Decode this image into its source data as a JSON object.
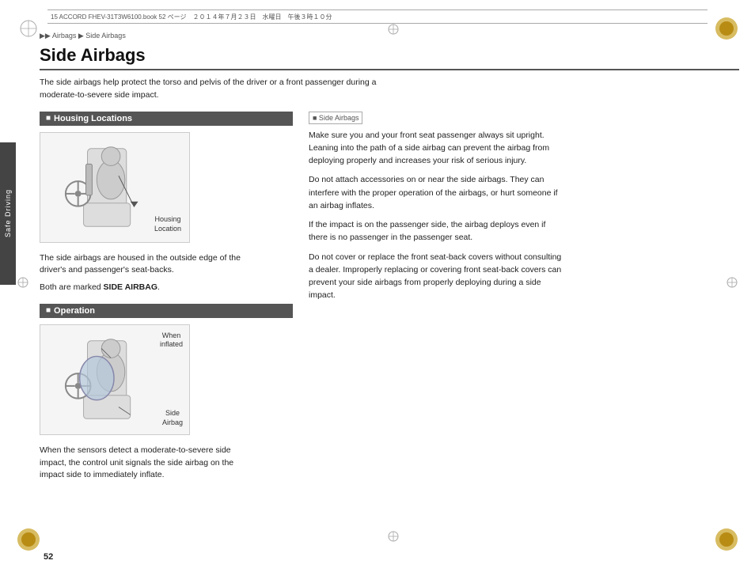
{
  "header": {
    "file_info": "15 ACCORD FHEV-31T3W6100.book  52 ページ　２０１４年７月２３日　水曜日　午後３時１０分"
  },
  "breadcrumb": {
    "text": "▶▶ Airbags ▶ Side Airbags"
  },
  "page_title": "Side Airbags",
  "intro_text": "The side airbags help protect the torso and pelvis of the driver or a front passenger during a moderate-to-severe side impact.",
  "sidebar_tab": "Safe Driving",
  "sections": {
    "housing": {
      "title": "Housing Locations",
      "description": "The side airbags are housed in the outside edge of the driver's and passenger's seat-backs.",
      "note": "Both are marked ",
      "bold_note": "SIDE AIRBAG",
      "diagram_label": "Housing\nLocation"
    },
    "operation": {
      "title": "Operation",
      "description": "When the sensors detect a moderate-to-severe side impact, the control unit signals the side airbag on the impact side to immediately inflate.",
      "label_when": "When\ninflated",
      "label_airbag": "Side\nAirbag"
    }
  },
  "warning": {
    "header": "■ Side Airbags",
    "paragraphs": [
      "Make sure you and your front seat passenger always sit upright. Leaning into the path of a side airbag can prevent the airbag from deploying properly and increases your risk of serious injury.",
      "Do not attach accessories on or near the side airbags. They can interfere with the proper operation of the airbags, or hurt someone if an airbag inflates.",
      "If the impact is on the passenger side, the airbag deploys even if there is no passenger in the passenger seat.",
      "Do not cover or replace the front seat-back covers without consulting a dealer.\nImproperly replacing or covering front seat-back covers can prevent your side airbags from properly deploying during a side impact."
    ]
  },
  "page_number": "52"
}
